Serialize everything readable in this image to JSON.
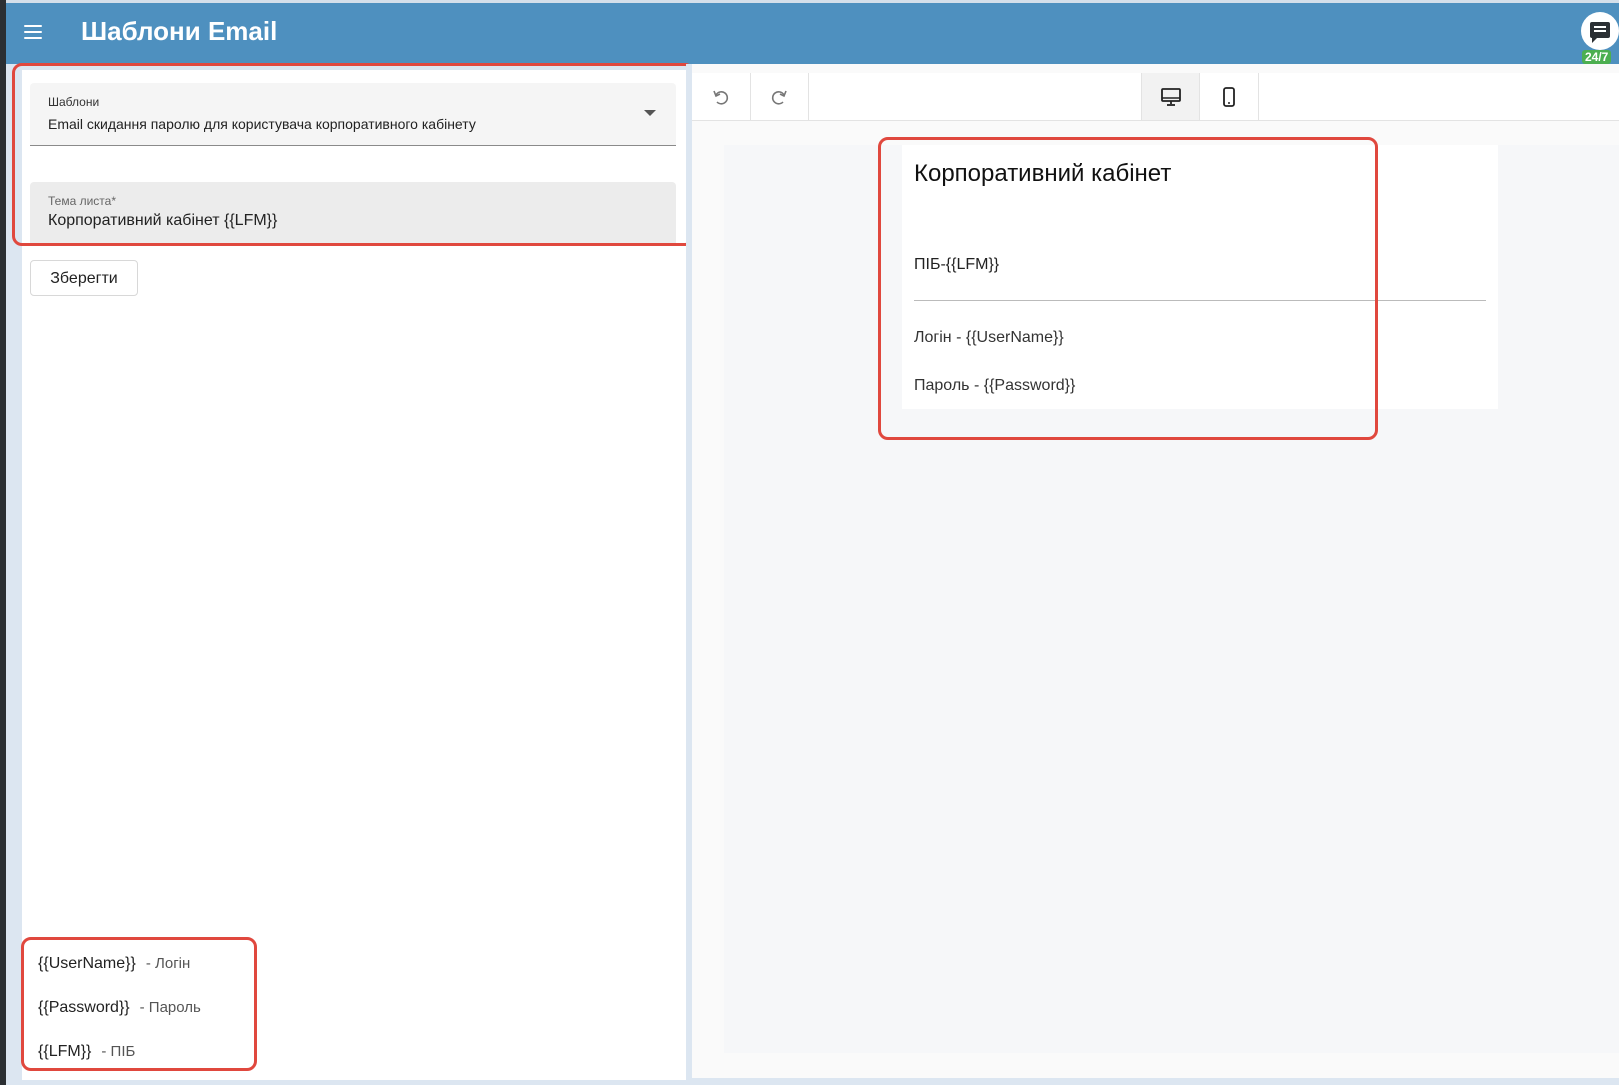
{
  "header": {
    "title": "Шаблони Email",
    "chat_badge": "24/7"
  },
  "form": {
    "templates_label": "Шаблони",
    "templates_selected": "Email скидання паролю для користувача корпоративного кабінету",
    "subject_label": "Тема листа*",
    "subject_value": "Корпоративний кабінет {{LFM}}",
    "save_label": "Зберегти"
  },
  "legend": [
    {
      "token": "{{UserName}}",
      "desc": "- Логін"
    },
    {
      "token": "{{Password}}",
      "desc": "- Пароль"
    },
    {
      "token": "{{LFM}}",
      "desc": "- ПІБ"
    }
  ],
  "preview": {
    "heading": "Корпоративний кабінет",
    "line1": "ПІБ-{{LFM}}",
    "line2": "Логін - {{UserName}}",
    "line3": "Пароль - {{Password}}"
  },
  "toolbar": {
    "icons": [
      "undo-icon",
      "redo-icon",
      "desktop-icon",
      "mobile-icon"
    ],
    "active_device": "desktop"
  },
  "colors": {
    "header_bg": "#4e90bf",
    "highlight": "#e0483e",
    "badge": "#4caf50"
  }
}
